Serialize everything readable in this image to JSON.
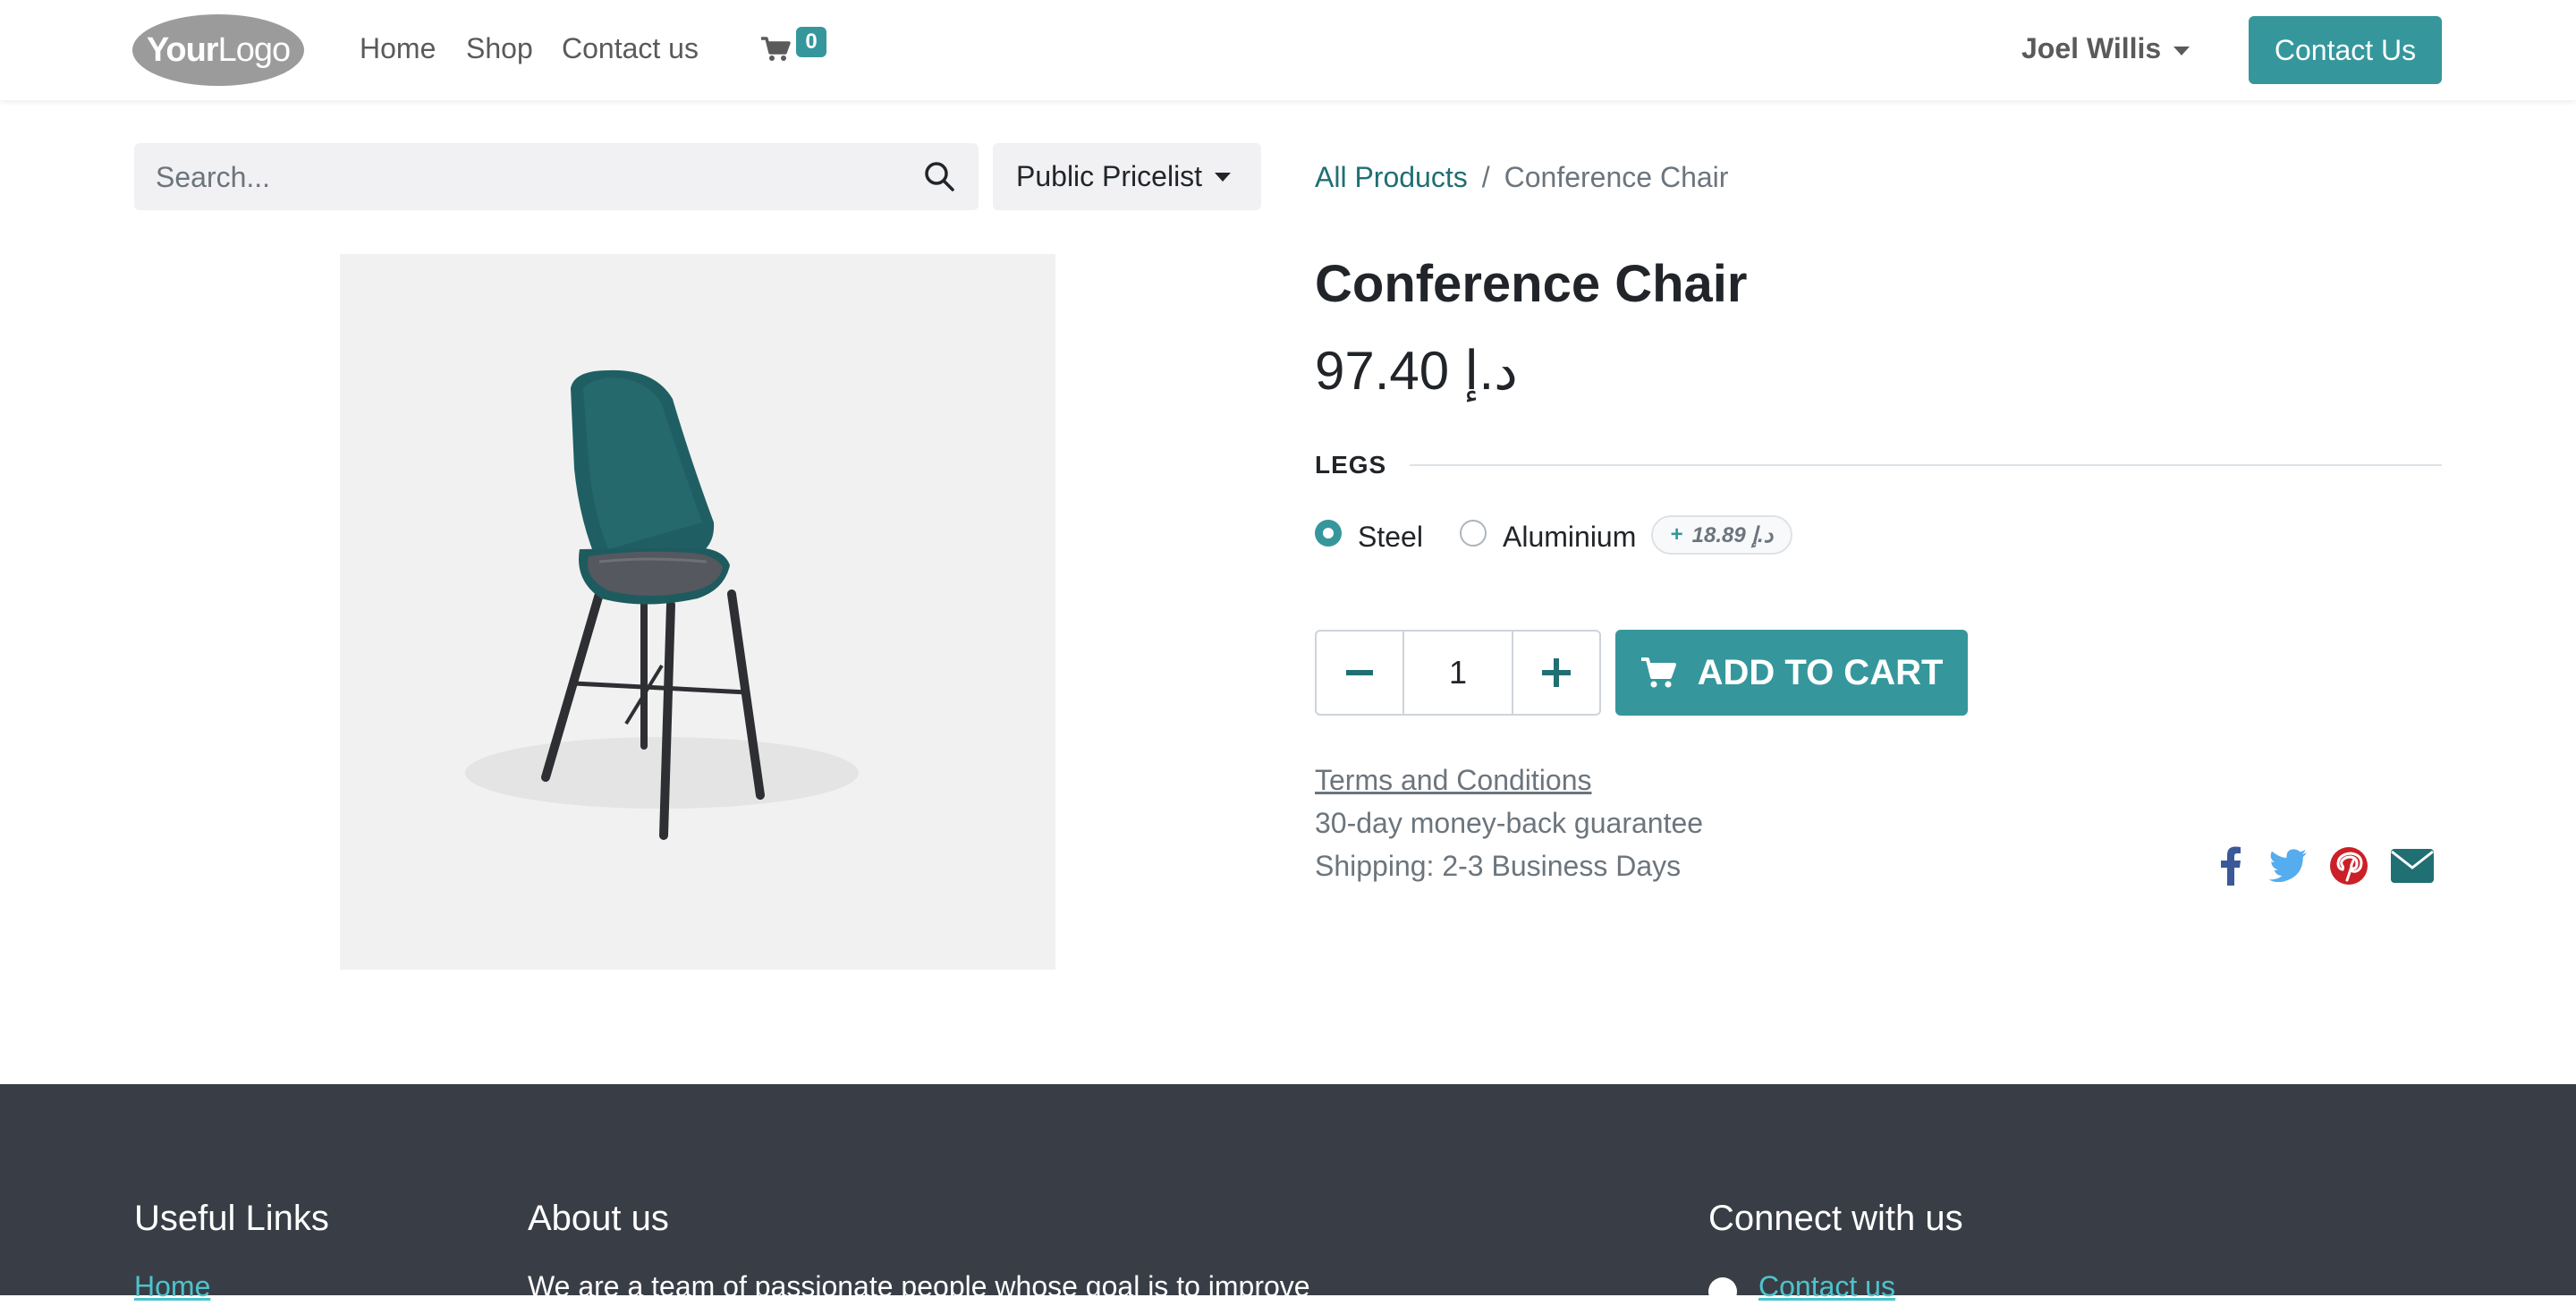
{
  "header": {
    "logo_bold": "Your",
    "logo_light": "Logo",
    "nav": [
      "Home",
      "Shop",
      "Contact us"
    ],
    "cart_count": "0",
    "user_name": "Joel Willis",
    "contact_button": "Contact Us"
  },
  "search": {
    "placeholder": "Search...",
    "value": ""
  },
  "pricelist": {
    "label": "Public Pricelist"
  },
  "breadcrumb": {
    "parent": "All Products",
    "separator": "/",
    "current": "Conference Chair"
  },
  "product": {
    "title": "Conference Chair",
    "price": "97.40 د.إ",
    "attribute_label": "LEGS",
    "options": [
      {
        "label": "Steel",
        "checked": true
      },
      {
        "label": "Aluminium",
        "checked": false,
        "extra_sign": "+",
        "extra_amount": "18.89 د.إ"
      }
    ],
    "quantity": "1",
    "add_to_cart": "ADD TO CART",
    "terms": "Terms and Conditions",
    "guarantee": "30-day money-back guarantee",
    "shipping": "Shipping: 2-3 Business Days"
  },
  "share_icons": [
    "facebook-icon",
    "twitter-icon",
    "pinterest-icon",
    "email-icon"
  ],
  "colors": {
    "primary": "#35979c",
    "footer_bg": "#393e46",
    "facebook": "#3b5998",
    "twitter": "#55acee",
    "pinterest": "#cb2027",
    "email": "#1f6f73"
  },
  "footer": {
    "useful_links_heading": "Useful Links",
    "useful_links_first": "Home",
    "about_heading": "About us",
    "about_text": "We are a team of passionate people whose goal is to improve",
    "connect_heading": "Connect with us",
    "connect_first": "Contact us"
  }
}
